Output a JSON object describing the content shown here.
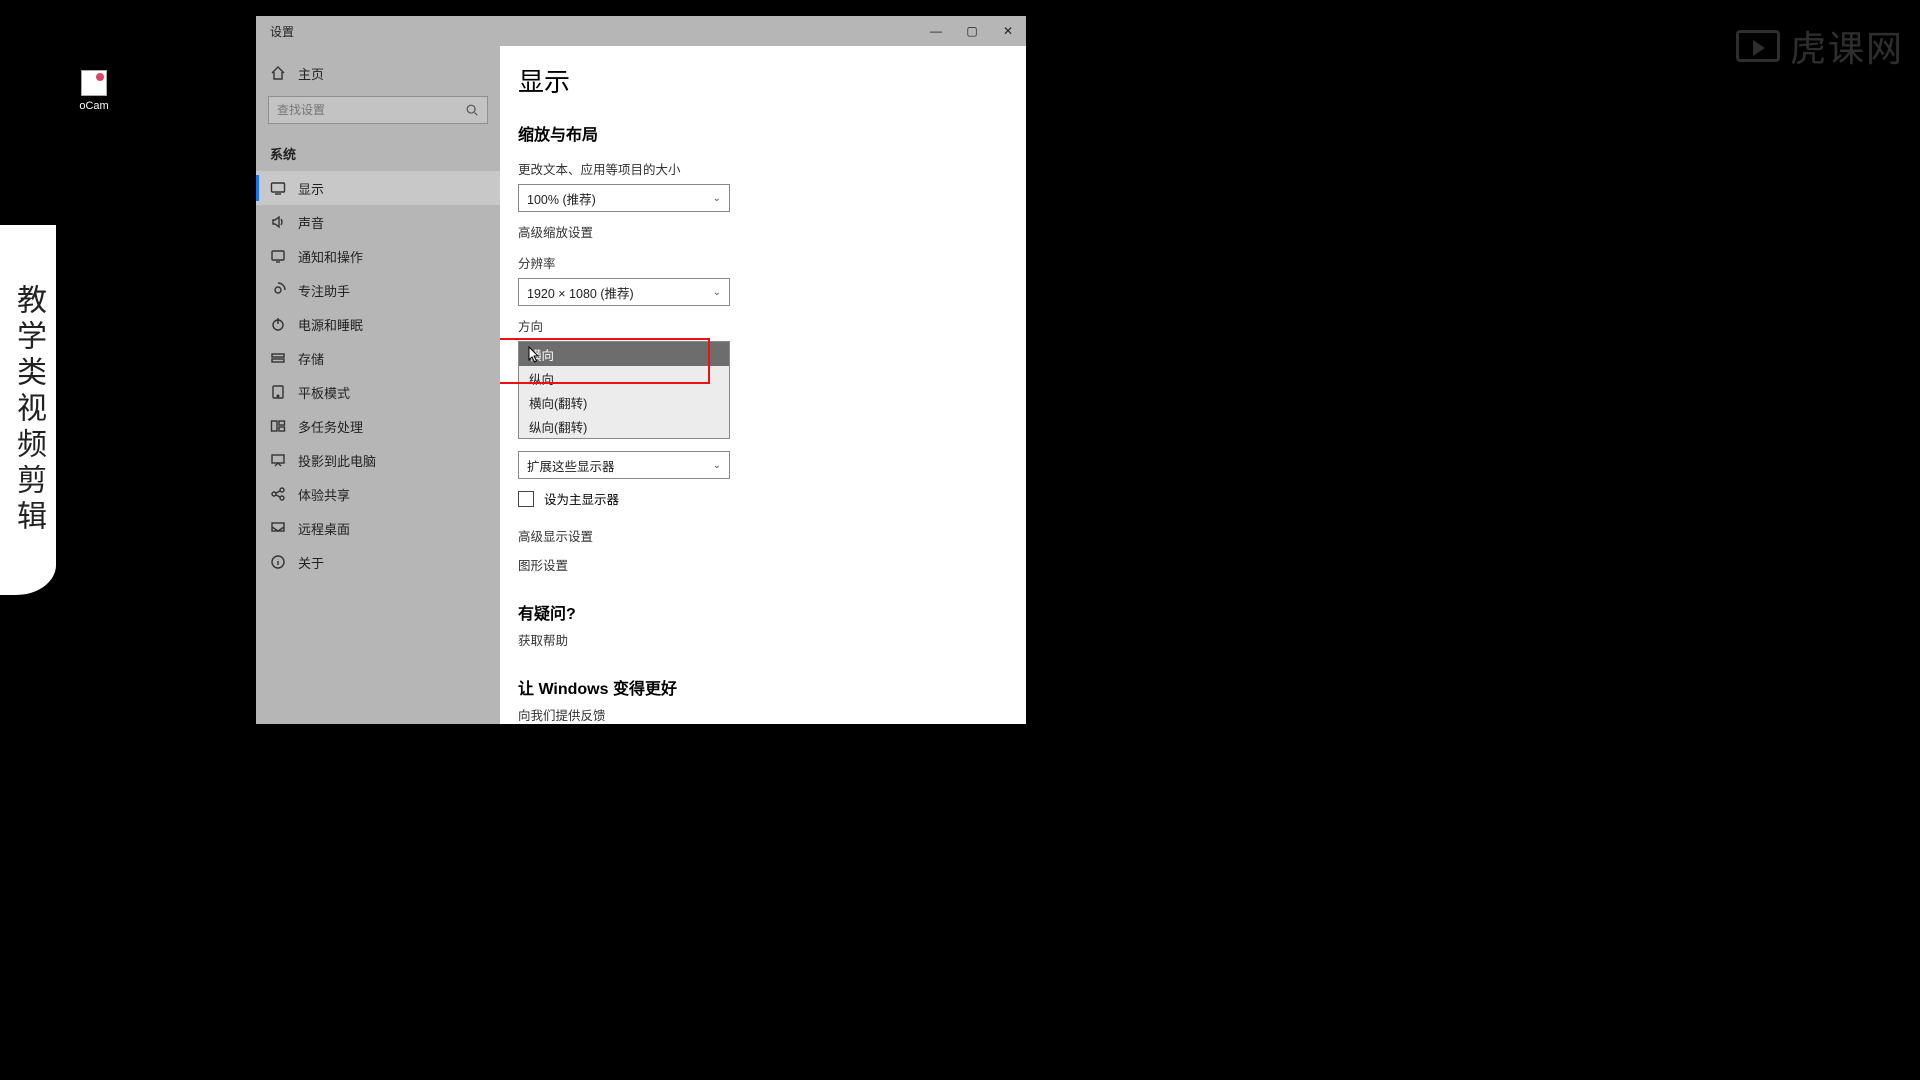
{
  "desktop": {
    "icon_label": "oCam"
  },
  "banner_text": "教学类视频剪辑",
  "watermark_text": "虎课网",
  "window": {
    "title": "设置",
    "controls": {
      "min": "—",
      "max": "▢",
      "close": "✕"
    }
  },
  "sidebar": {
    "home": "主页",
    "search_placeholder": "查找设置",
    "section": "系统",
    "items": [
      {
        "label": "显示"
      },
      {
        "label": "声音"
      },
      {
        "label": "通知和操作"
      },
      {
        "label": "专注助手"
      },
      {
        "label": "电源和睡眠"
      },
      {
        "label": "存储"
      },
      {
        "label": "平板模式"
      },
      {
        "label": "多任务处理"
      },
      {
        "label": "投影到此电脑"
      },
      {
        "label": "体验共享"
      },
      {
        "label": "远程桌面"
      },
      {
        "label": "关于"
      }
    ]
  },
  "main": {
    "title": "显示",
    "scale_section": "缩放与布局",
    "scale_label": "更改文本、应用等项目的大小",
    "scale_value": "100% (推荐)",
    "adv_scale": "高级缩放设置",
    "res_label": "分辨率",
    "res_value": "1920 × 1080 (推荐)",
    "orient_label": "方向",
    "orient_options": [
      "横向",
      "纵向",
      "横向(翻转)",
      "纵向(翻转)"
    ],
    "multi_value": "扩展这些显示器",
    "main_display_cb": "设为主显示器",
    "adv_display": "高级显示设置",
    "graphics": "图形设置",
    "question_h": "有疑问?",
    "get_help": "获取帮助",
    "better_h": "让 Windows 变得更好",
    "feedback": "向我们提供反馈"
  }
}
